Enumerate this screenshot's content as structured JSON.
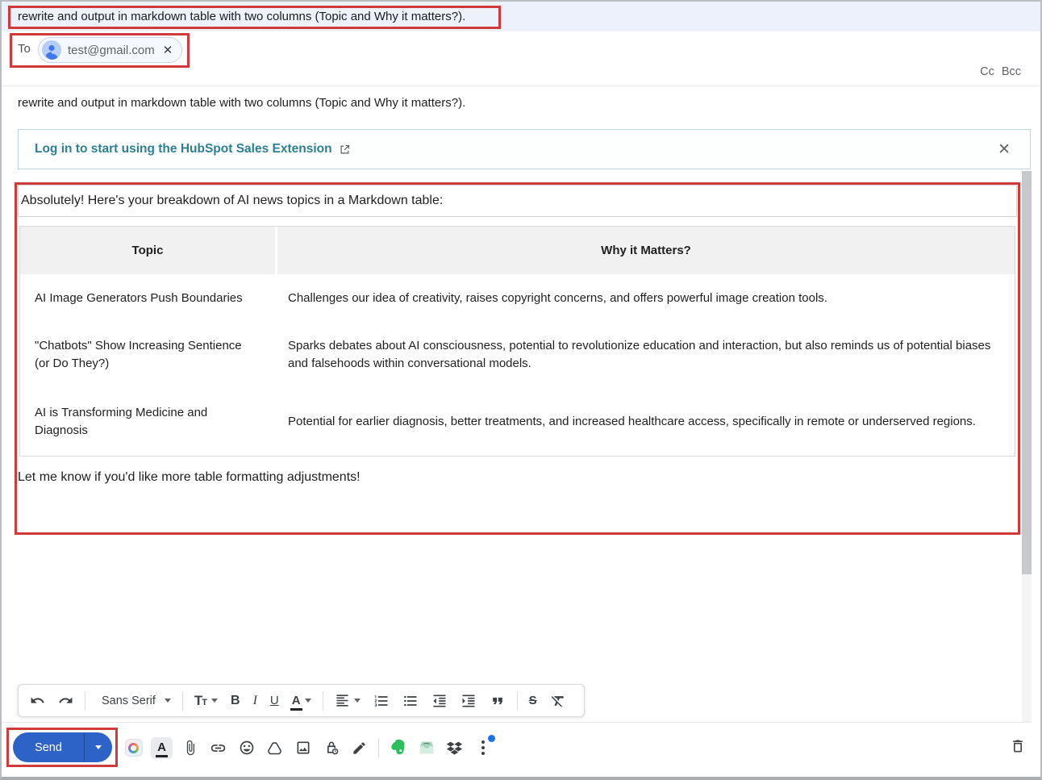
{
  "subject": "rewrite and output in markdown table with two columns (Topic and Why it matters?).",
  "recipients": {
    "to_label": "To",
    "chip_email": "test@gmail.com",
    "remove_symbol": "✕",
    "cc": "Cc",
    "bcc": "Bcc"
  },
  "body": {
    "first_line": "rewrite and output in markdown table with two columns (Topic and Why it matters?).",
    "banner_text": "Log in to start using the HubSpot Sales Extension",
    "banner_close_symbol": "✕",
    "intro": "Absolutely! Here's your breakdown of AI news topics in a Markdown table:",
    "outro": "Let me know if you'd like more table formatting adjustments!"
  },
  "table": {
    "headers": [
      "Topic",
      "Why it Matters?"
    ],
    "rows": [
      [
        "AI Image Generators Push Boundaries",
        "Challenges our idea of creativity, raises copyright concerns, and offers powerful image creation tools."
      ],
      [
        "\"Chatbots\" Show Increasing Sentience (or Do They?)",
        "Sparks debates about AI consciousness, potential to revolutionize education and interaction, but also reminds us of potential biases and falsehoods within conversational models."
      ],
      [
        "AI is Transforming Medicine and Diagnosis",
        "Potential for earlier diagnosis, better treatments, and increased healthcare access, specifically in remote or underserved regions."
      ]
    ]
  },
  "toolbar": {
    "font_family": "Sans Serif",
    "size_t1": "T",
    "size_t2": "T",
    "bold": "B",
    "italic": "I",
    "underline": "U",
    "text_color": "A",
    "strike": "S"
  },
  "footer": {
    "send": "Send",
    "icons": [
      "ai-extension",
      "formatting-options",
      "attach-file",
      "insert-link",
      "insert-emoji",
      "google-drive",
      "insert-photo",
      "confidential-mode",
      "insert-signature",
      "evernote",
      "mail-tray-extension",
      "dropbox",
      "more-options",
      "discard-draft"
    ]
  },
  "colors": {
    "annotation_red": "#d03a3a",
    "send_blue": "#2d62c6",
    "hubspot_teal": "#2e7f93",
    "subject_row_bg": "#edf1fb",
    "table_header_bg": "#f1f1f2",
    "notification_blue": "#1a73e8"
  }
}
